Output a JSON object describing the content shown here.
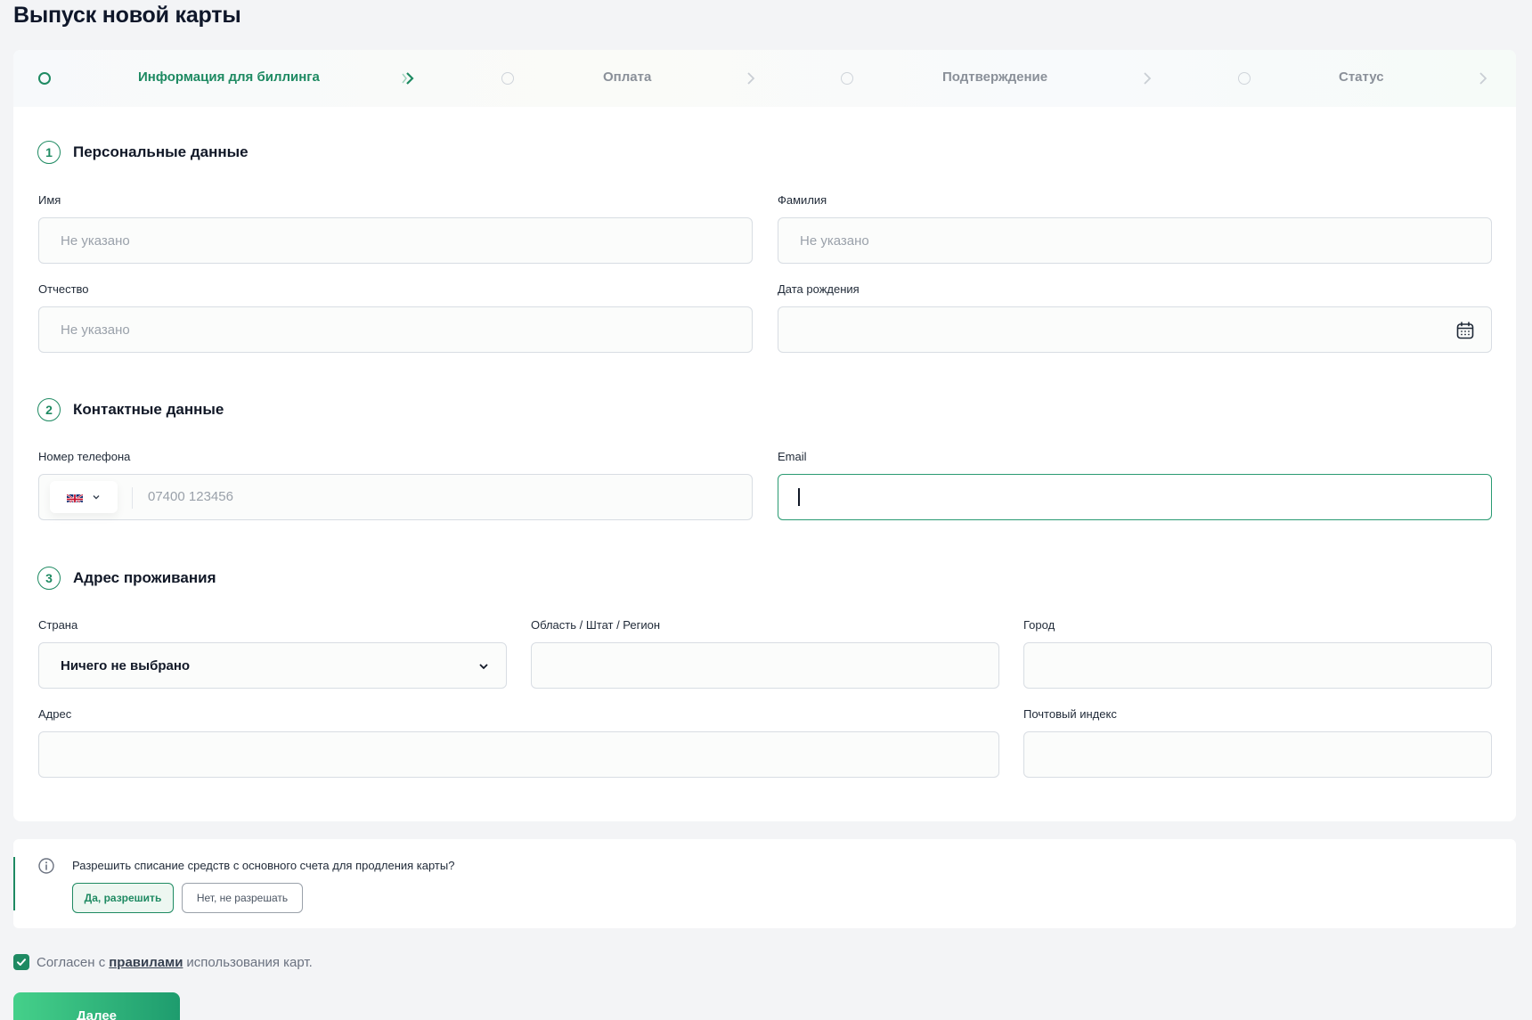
{
  "page": {
    "title": "Выпуск новой карты"
  },
  "stepper": {
    "steps": [
      {
        "label": "Информация для биллинга",
        "active": true
      },
      {
        "label": "Оплата",
        "active": false
      },
      {
        "label": "Подтверждение",
        "active": false
      },
      {
        "label": "Статус",
        "active": false
      }
    ]
  },
  "sections": {
    "personal": {
      "number": "1",
      "title": "Персональные данные"
    },
    "contacts": {
      "number": "2",
      "title": "Контактные данные"
    },
    "address": {
      "number": "3",
      "title": "Адрес проживания"
    }
  },
  "fields": {
    "first_name": {
      "label": "Имя",
      "placeholder": "Не указано"
    },
    "last_name": {
      "label": "Фамилия",
      "placeholder": "Не указано"
    },
    "middle_name": {
      "label": "Отчество",
      "placeholder": "Не указано"
    },
    "birth_date": {
      "label": "Дата рождения",
      "value": ""
    },
    "phone": {
      "label": "Номер телефона",
      "placeholder": "07400 123456",
      "country_icon": "uk-flag-icon"
    },
    "email": {
      "label": "Email",
      "value": ""
    },
    "country": {
      "label": "Страна",
      "value": "Ничего не выбрано"
    },
    "region": {
      "label": "Область / Штат / Регион",
      "value": ""
    },
    "city": {
      "label": "Город",
      "value": ""
    },
    "address": {
      "label": "Адрес",
      "value": ""
    },
    "postal_code": {
      "label": "Почтовый индекс",
      "value": ""
    }
  },
  "autopay": {
    "question": "Разрешить списание средств с основного счета для продления карты?",
    "yes_label": "Да, разрешить",
    "no_label": "Нет, не разрешать"
  },
  "agreement": {
    "prefix": "Согласен с",
    "link": "правилами",
    "suffix": "использования карт.",
    "checked": true
  },
  "actions": {
    "next_label": "Далее"
  },
  "colors": {
    "accent": "#1e8a62",
    "button_gradient_start": "#45d08a",
    "button_gradient_end": "#1e9c6e"
  }
}
